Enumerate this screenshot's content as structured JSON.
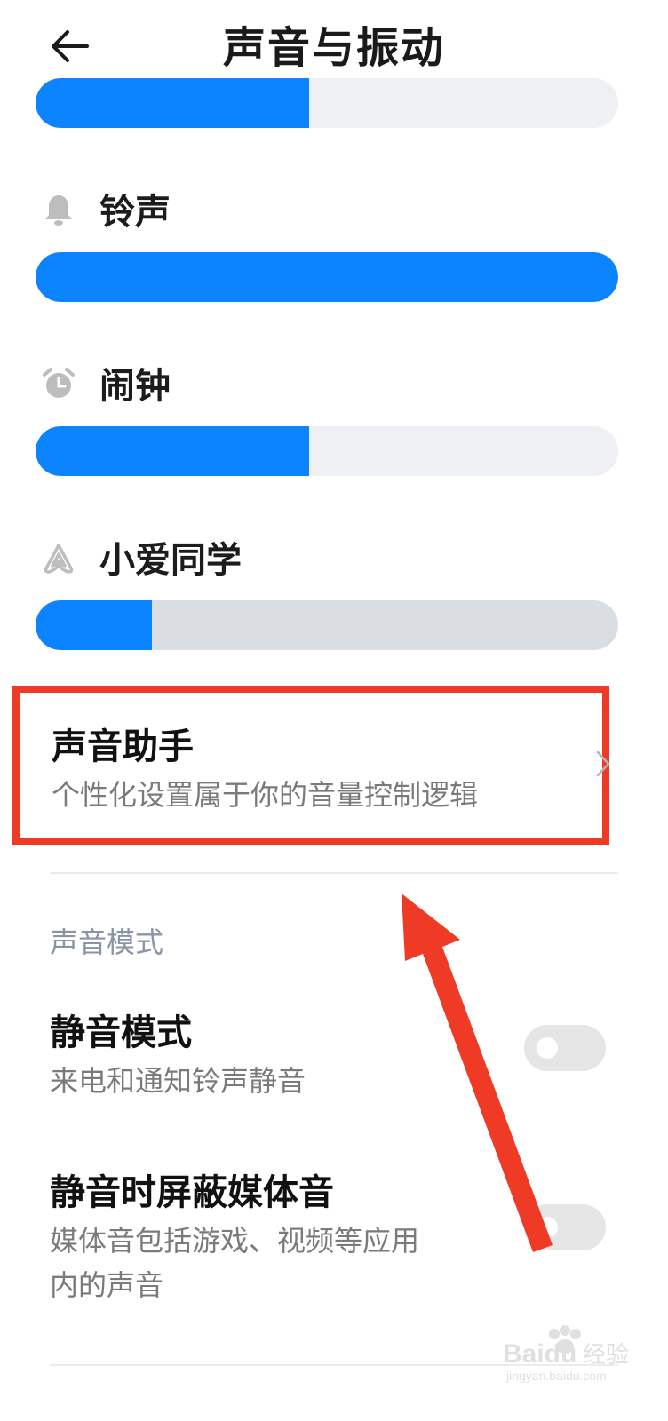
{
  "header": {
    "title": "声音与振动"
  },
  "volumes": {
    "media": {
      "level_percent": 47
    },
    "ringtone": {
      "label": "铃声",
      "icon": "bell-icon",
      "level_percent": 100
    },
    "alarm": {
      "label": "闹钟",
      "icon": "alarm-clock-icon",
      "level_percent": 47
    },
    "xiaoai": {
      "label": "小爱同学",
      "icon": "xiaoai-icon",
      "level_percent": 20
    }
  },
  "assistant": {
    "title": "声音助手",
    "subtitle": "个性化设置属于你的音量控制逻辑",
    "highlight_color": "#ef3a25"
  },
  "sound_mode": {
    "section_title": "声音模式",
    "silent_mode": {
      "title": "静音模式",
      "subtitle": "来电和通知铃声静音",
      "enabled": false
    },
    "mute_media": {
      "title": "静音时屏蔽媒体音",
      "subtitle_line1": "媒体音包括游戏、视频等应用",
      "subtitle_line2": "内的声音",
      "enabled": false
    }
  },
  "colors": {
    "accent": "#0d84ff",
    "annotation": "#ef3a25"
  },
  "watermark": {
    "logo_text": "Baidu",
    "logo_suffix": "经验",
    "url": "jingyan.baidu.com"
  }
}
